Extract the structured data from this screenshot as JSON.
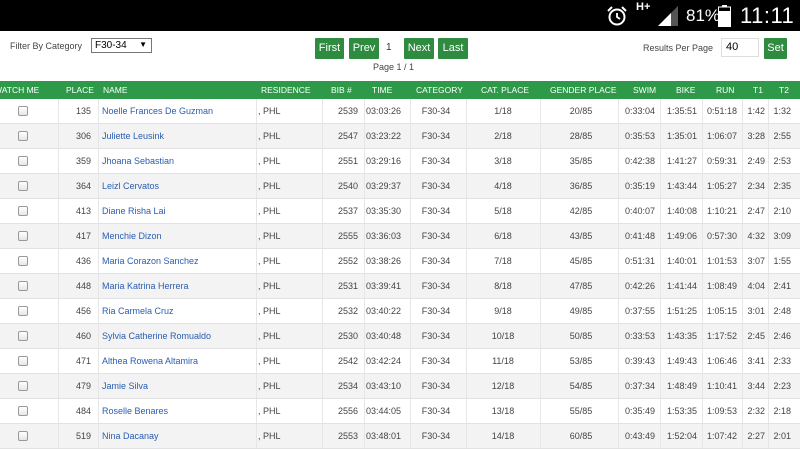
{
  "status_bar": {
    "network": "H+",
    "battery": "81%",
    "time": "11:11",
    "icons": [
      "alarm-icon",
      "signal-icon",
      "battery-icon"
    ]
  },
  "filter": {
    "label": "Filter By Category",
    "selected": "F30-34"
  },
  "pager": {
    "first": "First",
    "prev": "Prev",
    "current": "1",
    "next": "Next",
    "last": "Last",
    "page_info": "Page 1 / 1"
  },
  "results_per_page": {
    "label": "Results Per Page",
    "value": "40",
    "set": "Set"
  },
  "colors": {
    "accent": "#2e8b3f",
    "header": "#2e9a49",
    "link": "#2a5db0"
  },
  "table": {
    "headers": {
      "watch": "WATCH ME",
      "place": "PLACE",
      "name": "NAME",
      "residence": "RESIDENCE",
      "bib": "BIB #",
      "time": "TIME",
      "category": "CATEGORY",
      "cat_place": "CAT. PLACE",
      "gender_place": "GENDER PLACE",
      "swim": "SWIM",
      "bike": "BIKE",
      "run": "RUN",
      "t1": "T1",
      "t2": "T2"
    },
    "rows": [
      {
        "place": "135",
        "name": "Noelle Frances De Guzman",
        "residence": ", PHL",
        "bib": "2539",
        "time": "03:03:26",
        "category": "F30-34",
        "cat_place": "1/18",
        "gender_place": "20/85",
        "swim": "0:33:04",
        "bike": "1:35:51",
        "run": "0:51:18",
        "t1": "1:42",
        "t2": "1:32"
      },
      {
        "place": "306",
        "name": "Juliette Leusink",
        "residence": ", PHL",
        "bib": "2547",
        "time": "03:23:22",
        "category": "F30-34",
        "cat_place": "2/18",
        "gender_place": "28/85",
        "swim": "0:35:53",
        "bike": "1:35:01",
        "run": "1:06:07",
        "t1": "3:28",
        "t2": "2:55"
      },
      {
        "place": "359",
        "name": "Jhoana Sebastian",
        "residence": ", PHL",
        "bib": "2551",
        "time": "03:29:16",
        "category": "F30-34",
        "cat_place": "3/18",
        "gender_place": "35/85",
        "swim": "0:42:38",
        "bike": "1:41:27",
        "run": "0:59:31",
        "t1": "2:49",
        "t2": "2:53"
      },
      {
        "place": "364",
        "name": "Leizl Cervatos",
        "residence": ", PHL",
        "bib": "2540",
        "time": "03:29:37",
        "category": "F30-34",
        "cat_place": "4/18",
        "gender_place": "36/85",
        "swim": "0:35:19",
        "bike": "1:43:44",
        "run": "1:05:27",
        "t1": "2:34",
        "t2": "2:35"
      },
      {
        "place": "413",
        "name": "Diane Risha Lai",
        "residence": ", PHL",
        "bib": "2537",
        "time": "03:35:30",
        "category": "F30-34",
        "cat_place": "5/18",
        "gender_place": "42/85",
        "swim": "0:40:07",
        "bike": "1:40:08",
        "run": "1:10:21",
        "t1": "2:47",
        "t2": "2:10"
      },
      {
        "place": "417",
        "name": "Menchie Dizon",
        "residence": ", PHL",
        "bib": "2555",
        "time": "03:36:03",
        "category": "F30-34",
        "cat_place": "6/18",
        "gender_place": "43/85",
        "swim": "0:41:48",
        "bike": "1:49:06",
        "run": "0:57:30",
        "t1": "4:32",
        "t2": "3:09"
      },
      {
        "place": "436",
        "name": "Maria Corazon Sanchez",
        "residence": ", PHL",
        "bib": "2552",
        "time": "03:38:26",
        "category": "F30-34",
        "cat_place": "7/18",
        "gender_place": "45/85",
        "swim": "0:51:31",
        "bike": "1:40:01",
        "run": "1:01:53",
        "t1": "3:07",
        "t2": "1:55"
      },
      {
        "place": "448",
        "name": "Maria Katrina Herrera",
        "residence": ", PHL",
        "bib": "2531",
        "time": "03:39:41",
        "category": "F30-34",
        "cat_place": "8/18",
        "gender_place": "47/85",
        "swim": "0:42:26",
        "bike": "1:41:44",
        "run": "1:08:49",
        "t1": "4:04",
        "t2": "2:41"
      },
      {
        "place": "456",
        "name": "Ria Carmela Cruz",
        "residence": ", PHL",
        "bib": "2532",
        "time": "03:40:22",
        "category": "F30-34",
        "cat_place": "9/18",
        "gender_place": "49/85",
        "swim": "0:37:55",
        "bike": "1:51:25",
        "run": "1:05:15",
        "t1": "3:01",
        "t2": "2:48"
      },
      {
        "place": "460",
        "name": "Sylvia Catherine Romualdo",
        "residence": ", PHL",
        "bib": "2530",
        "time": "03:40:48",
        "category": "F30-34",
        "cat_place": "10/18",
        "gender_place": "50/85",
        "swim": "0:33:53",
        "bike": "1:43:35",
        "run": "1:17:52",
        "t1": "2:45",
        "t2": "2:46"
      },
      {
        "place": "471",
        "name": "Althea Rowena Altamira",
        "residence": ", PHL",
        "bib": "2542",
        "time": "03:42:24",
        "category": "F30-34",
        "cat_place": "11/18",
        "gender_place": "53/85",
        "swim": "0:39:43",
        "bike": "1:49:43",
        "run": "1:06:46",
        "t1": "3:41",
        "t2": "2:33"
      },
      {
        "place": "479",
        "name": "Jamie Silva",
        "residence": ", PHL",
        "bib": "2534",
        "time": "03:43:10",
        "category": "F30-34",
        "cat_place": "12/18",
        "gender_place": "54/85",
        "swim": "0:37:34",
        "bike": "1:48:49",
        "run": "1:10:41",
        "t1": "3:44",
        "t2": "2:23"
      },
      {
        "place": "484",
        "name": "Roselle Benares",
        "residence": ", PHL",
        "bib": "2556",
        "time": "03:44:05",
        "category": "F30-34",
        "cat_place": "13/18",
        "gender_place": "55/85",
        "swim": "0:35:49",
        "bike": "1:53:35",
        "run": "1:09:53",
        "t1": "2:32",
        "t2": "2:18"
      },
      {
        "place": "519",
        "name": "Nina Dacanay",
        "residence": ", PHL",
        "bib": "2553",
        "time": "03:48:01",
        "category": "F30-34",
        "cat_place": "14/18",
        "gender_place": "60/85",
        "swim": "0:43:49",
        "bike": "1:52:04",
        "run": "1:07:42",
        "t1": "2:27",
        "t2": "2:01"
      }
    ]
  }
}
